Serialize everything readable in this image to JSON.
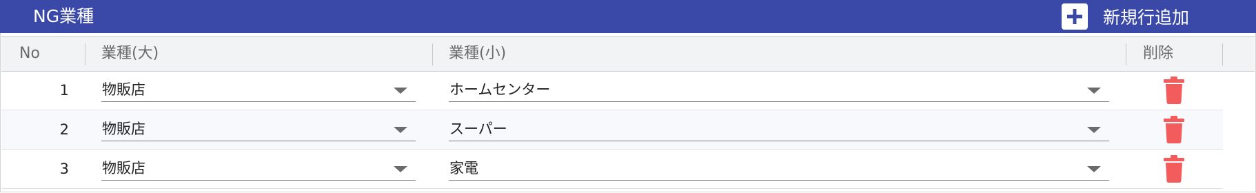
{
  "panel": {
    "title": "NG業種",
    "add_label": "新規行追加"
  },
  "table": {
    "headers": {
      "no": "No",
      "large": "業種(大)",
      "small": "業種(小)",
      "delete": "削除"
    },
    "rows": [
      {
        "no": "1",
        "large": "物販店",
        "small": "ホームセンター"
      },
      {
        "no": "2",
        "large": "物販店",
        "small": "スーパー"
      },
      {
        "no": "3",
        "large": "物販店",
        "small": "家電"
      }
    ]
  },
  "icons": {
    "add": "plus-icon",
    "delete": "trash-icon",
    "dropdown": "chevron-down-icon"
  },
  "colors": {
    "header_bg": "#3a48a8",
    "delete_icon": "#f25c5c",
    "table_header_bg": "#f2f3f5"
  }
}
